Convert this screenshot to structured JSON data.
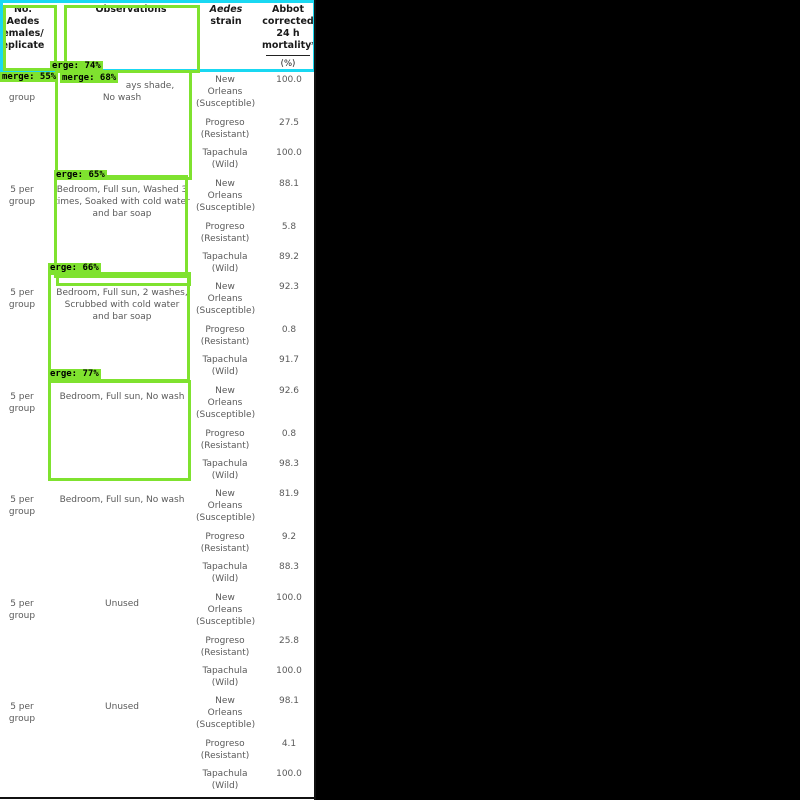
{
  "headers": {
    "group_lines": [
      "No.",
      "Aedes",
      "emales/",
      "eplicate"
    ],
    "observations": "Observations",
    "strain_lines": [
      "Aedes",
      "strain"
    ],
    "mortality_lines": [
      "Abbot",
      "corrected",
      "24 h",
      "mortality*"
    ],
    "mortality_unit": "(%)"
  },
  "rows": [
    {
      "group_lines": [
        "",
        "group"
      ],
      "obs_lines": [
        "",
        "No wash"
      ],
      "strains": [
        {
          "lines": [
            "New",
            "Orleans",
            "(Susceptible)"
          ],
          "mortality": "100.0"
        },
        {
          "lines": [
            "Progreso",
            "(Resistant)"
          ],
          "mortality": "27.5"
        },
        {
          "lines": [
            "Tapachula",
            "(Wild)"
          ],
          "mortality": "100.0"
        }
      ]
    },
    {
      "group_lines": [
        "5 per",
        "group"
      ],
      "obs_lines": [
        "Bedroom, Full sun, Washed 3",
        "times, Soaked with cold water",
        "and bar soap"
      ],
      "strains": [
        {
          "lines": [
            "New",
            "Orleans",
            "(Susceptible)"
          ],
          "mortality": "88.1"
        },
        {
          "lines": [
            "Progreso",
            "(Resistant)"
          ],
          "mortality": "5.8"
        },
        {
          "lines": [
            "Tapachula",
            "(Wild)"
          ],
          "mortality": "89.2"
        }
      ]
    },
    {
      "group_lines": [
        "5 per",
        "group"
      ],
      "obs_lines": [
        "Bedroom, Full sun, 2 washes,",
        "Scrubbed with cold water",
        "and bar soap"
      ],
      "strains": [
        {
          "lines": [
            "New",
            "Orleans",
            "(Susceptible)"
          ],
          "mortality": "92.3"
        },
        {
          "lines": [
            "Progreso",
            "(Resistant)"
          ],
          "mortality": "0.8"
        },
        {
          "lines": [
            "Tapachula",
            "(Wild)"
          ],
          "mortality": "91.7"
        }
      ]
    },
    {
      "group_lines": [
        "5 per",
        "group"
      ],
      "obs_lines": [
        "Bedroom, Full sun, No wash"
      ],
      "strains": [
        {
          "lines": [
            "New",
            "Orleans",
            "(Susceptible)"
          ],
          "mortality": "92.6"
        },
        {
          "lines": [
            "Progreso",
            "(Resistant)"
          ],
          "mortality": "0.8"
        },
        {
          "lines": [
            "Tapachula",
            "(Wild)"
          ],
          "mortality": "98.3"
        }
      ]
    },
    {
      "group_lines": [
        "5 per",
        "group"
      ],
      "obs_lines": [
        "Bedroom, Full sun, No wash"
      ],
      "strains": [
        {
          "lines": [
            "New",
            "Orleans",
            "(Susceptible)"
          ],
          "mortality": "81.9"
        },
        {
          "lines": [
            "Progreso",
            "(Resistant)"
          ],
          "mortality": "9.2"
        },
        {
          "lines": [
            "Tapachula",
            "(Wild)"
          ],
          "mortality": "88.3"
        }
      ]
    },
    {
      "group_lines": [
        "5 per",
        "group"
      ],
      "obs_lines": [
        "Unused"
      ],
      "strains": [
        {
          "lines": [
            "New",
            "Orleans",
            "(Susceptible)"
          ],
          "mortality": "100.0"
        },
        {
          "lines": [
            "Progreso",
            "(Resistant)"
          ],
          "mortality": "25.8"
        },
        {
          "lines": [
            "Tapachula",
            "(Wild)"
          ],
          "mortality": "100.0"
        }
      ]
    },
    {
      "group_lines": [
        "5 per",
        "group"
      ],
      "obs_lines": [
        "Unused"
      ],
      "strains": [
        {
          "lines": [
            "New",
            "Orleans",
            "(Susceptible)"
          ],
          "mortality": "98.1"
        },
        {
          "lines": [
            "Progreso",
            "(Resistant)"
          ],
          "mortality": "4.1"
        },
        {
          "lines": [
            "Tapachula",
            "(Wild)"
          ],
          "mortality": "100.0"
        }
      ]
    }
  ],
  "overlay": {
    "header_colors": {
      "box": "#7fe22f",
      "header_box": "#19d8f2"
    },
    "labels": [
      "erge: 74%",
      "merge: 55%",
      "merge: 68%",
      "erge: 65%",
      "erge: 66%",
      "erge: 77%"
    ],
    "row1_obs_fragment": "ays shade,"
  }
}
